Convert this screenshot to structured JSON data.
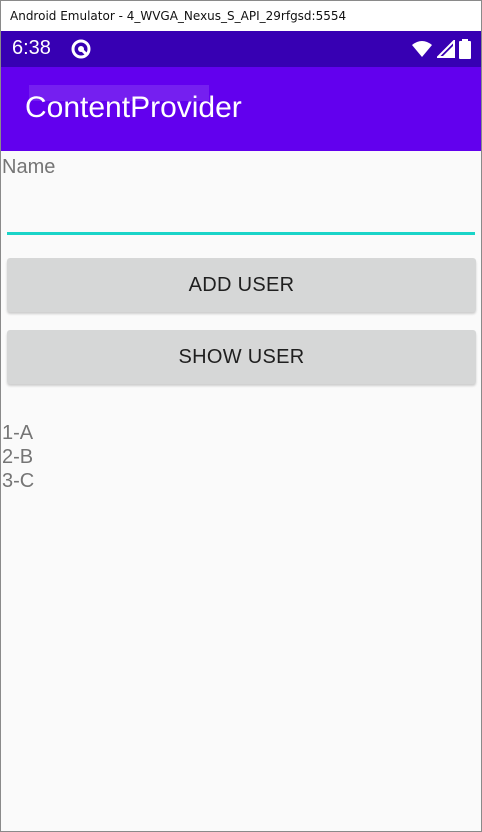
{
  "window": {
    "title": "Android Emulator - 4_WVGA_Nexus_S_API_29rfgsd:5554"
  },
  "status_bar": {
    "time": "6:38",
    "icons": [
      "sync-icon",
      "wifi-icon",
      "signal-icon",
      "battery-icon"
    ],
    "color": "#3700b3"
  },
  "app_bar": {
    "title": "ContentProvider",
    "color": "#6200ee"
  },
  "form": {
    "name_label": "Name",
    "name_value": "",
    "accent_color": "#1ad4c8"
  },
  "buttons": {
    "add_user": "ADD USER",
    "show_user": "SHOW USER"
  },
  "users": [
    "1-A",
    "2-B",
    "3-C"
  ]
}
